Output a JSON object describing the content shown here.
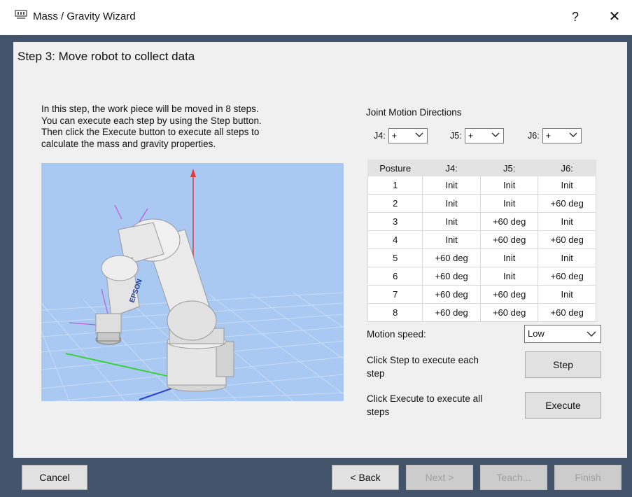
{
  "window": {
    "title": "Mass / Gravity Wizard",
    "help_label": "?",
    "close_label": "✕"
  },
  "step_title": "Step 3: Move robot to collect data",
  "instructions": [
    "In this step, the work piece will be moved in 8 steps.",
    "You can execute each step by using the Step button.",
    "Then click the Execute button to execute all steps to",
    "calculate the mass and gravity properties."
  ],
  "robot_logo": "EPSON",
  "joint_motion": {
    "label": "Joint Motion Directions",
    "selectors": [
      {
        "label": "J4:",
        "value": "+"
      },
      {
        "label": "J5:",
        "value": "+"
      },
      {
        "label": "J6:",
        "value": "+"
      }
    ]
  },
  "posture_table": {
    "headers": [
      "Posture",
      "J4:",
      "J5:",
      "J6:"
    ],
    "rows": [
      [
        "1",
        "Init",
        "Init",
        "Init"
      ],
      [
        "2",
        "Init",
        "Init",
        "+60 deg"
      ],
      [
        "3",
        "Init",
        "+60 deg",
        "Init"
      ],
      [
        "4",
        "Init",
        "+60 deg",
        "+60 deg"
      ],
      [
        "5",
        "+60 deg",
        "Init",
        "Init"
      ],
      [
        "6",
        "+60 deg",
        "Init",
        "+60 deg"
      ],
      [
        "7",
        "+60 deg",
        "+60 deg",
        "Init"
      ],
      [
        "8",
        "+60 deg",
        "+60 deg",
        "+60 deg"
      ]
    ]
  },
  "motion_speed": {
    "label": "Motion speed:",
    "value": "Low"
  },
  "step_help": [
    "Click Step to execute each",
    "step"
  ],
  "step_button": "Step",
  "execute_help": [
    "Click Execute to execute all",
    "steps"
  ],
  "execute_button": "Execute",
  "footer": {
    "cancel": "Cancel",
    "back": "< Back",
    "next": "Next >",
    "teach": "Teach...",
    "finish": "Finish"
  }
}
